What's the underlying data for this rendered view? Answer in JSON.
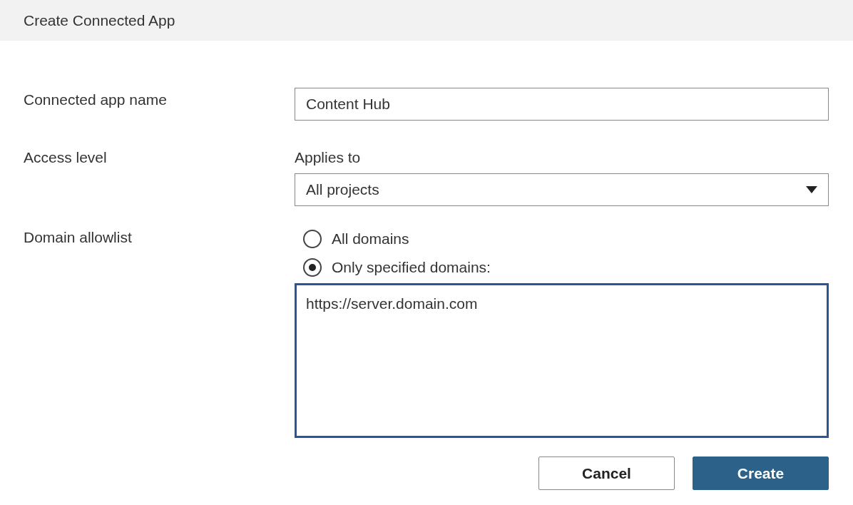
{
  "window": {
    "title": "Create Connected App"
  },
  "fields": [
    {
      "kind": "text",
      "label": "Connected app name",
      "value": "Content Hub"
    },
    {
      "kind": "select",
      "label": "Access level",
      "caption": "Applies to",
      "value": "All projects"
    },
    {
      "kind": "radio",
      "label": "Domain allowlist",
      "options": [
        {
          "label": "All domains",
          "selected": false
        },
        {
          "label": "Only specified domains:",
          "selected": true
        }
      ],
      "value": "https://server.domain.com"
    }
  ],
  "buttons": [
    {
      "label": "Cancel",
      "kind": "secondary"
    },
    {
      "label": "Create",
      "kind": "primary"
    }
  ]
}
